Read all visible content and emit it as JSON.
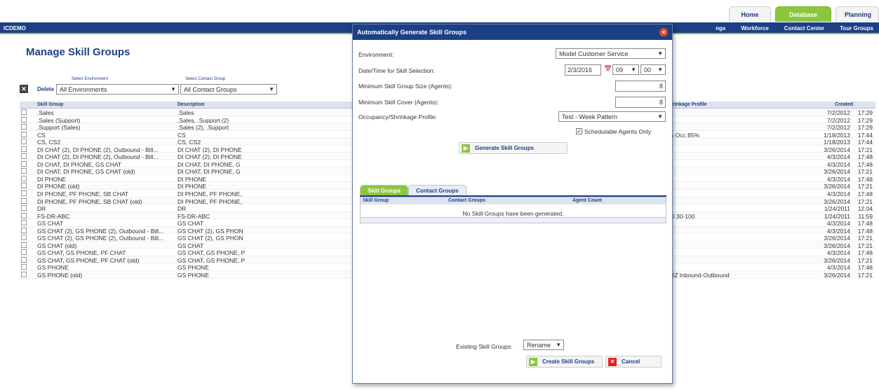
{
  "top_tabs": {
    "home": "Home",
    "database": "Database",
    "planning": "Planning"
  },
  "nav": {
    "brand": "ICDEMO",
    "links": [
      "ngs",
      "Workforce",
      "Contact Center",
      "Tour Groups"
    ]
  },
  "page": {
    "title": "Manage Skill Groups"
  },
  "filters": {
    "env_caption": "Select Environment",
    "cg_caption": "Select Contact Group",
    "delete_label": "Delete",
    "env_value": "All Environments",
    "cg_value": "All Contact Groups"
  },
  "grid": {
    "headers": {
      "skill_group": "Skill Group",
      "description": "Description",
      "profile": "/Shrinkage Profile",
      "created": "Created"
    },
    "rows": [
      {
        "name": ".Sales",
        "desc": ".Sales",
        "profile": "",
        "date": "7/2/2012",
        "time": "17:29"
      },
      {
        "name": ".Sales (Support)",
        "desc": ".Sales, .Support (2)",
        "profile": "",
        "date": "7/2/2012",
        "time": "17:29"
      },
      {
        "name": ".Support (Sales)",
        "desc": ".Sales (2), .Support",
        "profile": "",
        "date": "7/2/2012",
        "time": "17:29"
      },
      {
        "name": "CS",
        "desc": "CS",
        "profile": "3% Occ 85%",
        "date": "1/18/2013",
        "time": "17:44"
      },
      {
        "name": "CS, CS2",
        "desc": "CS, CS2",
        "profile": "",
        "date": "1/18/2013",
        "time": "17:44"
      },
      {
        "name": "DI CHAT (2), DI PHONE (2), Outbound - Bill...",
        "desc": "DI CHAT (2), DI PHONE",
        "profile": "",
        "date": "3/26/2014",
        "time": "17:21"
      },
      {
        "name": "DI CHAT (2), DI PHONE (2), Outbound - Bill...",
        "desc": "DI CHAT (2), DI PHONE",
        "profile": "",
        "date": "4/3/2014",
        "time": "17:48"
      },
      {
        "name": "DI CHAT, DI PHONE, GS CHAT",
        "desc": "DI CHAT, DI PHONE, G",
        "profile": "",
        "date": "4/3/2014",
        "time": "17:48"
      },
      {
        "name": "DI CHAT, DI PHONE, GS CHAT (old)",
        "desc": "DI CHAT, DI PHONE, G",
        "profile": "",
        "date": "3/26/2014",
        "time": "17:21"
      },
      {
        "name": "DI PHONE",
        "desc": "DI PHONE",
        "profile": "",
        "date": "4/3/2014",
        "time": "17:48"
      },
      {
        "name": "DI PHONE (old)",
        "desc": "DI PHONE",
        "profile": "",
        "date": "3/26/2014",
        "time": "17:21"
      },
      {
        "name": "DI PHONE, PF PHONE, SB CHAT",
        "desc": "DI PHONE, PF PHONE,",
        "profile": "",
        "date": "4/3/2014",
        "time": "17:48"
      },
      {
        "name": "DI PHONE, PF PHONE, SB CHAT (old)",
        "desc": "DI PHONE, PF PHONE,",
        "profile": "",
        "date": "3/26/2014",
        "time": "17:21"
      },
      {
        "name": "DR",
        "desc": "DR",
        "profile": "",
        "date": "1/24/2011",
        "time": "12:04"
      },
      {
        "name": "FS-DR-ABC",
        "desc": "FS-DR-ABC",
        "profile": "1-D 30-100",
        "date": "1/24/2011",
        "time": "11:59"
      },
      {
        "name": "GS CHAT",
        "desc": "GS CHAT",
        "profile": "",
        "date": "4/3/2014",
        "time": "17:48"
      },
      {
        "name": "GS CHAT (2), GS PHONE (2), Outbound - Bill...",
        "desc": "GS CHAT (2), GS PHON",
        "profile": "",
        "date": "4/3/2014",
        "time": "17:48"
      },
      {
        "name": "GS CHAT (2), GS PHONE (2), Outbound - Bill...",
        "desc": "GS CHAT (2), GS PHON",
        "profile": "",
        "date": "3/26/2014",
        "time": "17:21"
      },
      {
        "name": "GS CHAT (old)",
        "desc": "GS CHAT",
        "profile": "",
        "date": "3/26/2014",
        "time": "17:21"
      },
      {
        "name": "GS CHAT, GS PHONE, PF CHAT",
        "desc": "GS CHAT, GS PHONE, P",
        "profile": "",
        "date": "4/3/2014",
        "time": "17:48"
      },
      {
        "name": "GS CHAT, GS PHONE, PF CHAT (old)",
        "desc": "GS CHAT, GS PHONE, P",
        "profile": "",
        "date": "3/26/2014",
        "time": "17:21"
      },
      {
        "name": "GS PHONE",
        "desc": "GS PHONE",
        "profile": "",
        "date": "4/3/2014",
        "time": "17:48"
      },
      {
        "name": "GS PHONE (old)",
        "desc": "GS PHONE",
        "profile": "MRZ Inbound-Outbound",
        "date": "3/26/2014",
        "time": "17:21"
      }
    ]
  },
  "modal": {
    "title": "Automatically Generate Skill Groups",
    "environment_label": "Environment:",
    "environment_value": "Model Customer Service",
    "datetime_label": "Date/Time for Skill Selection:",
    "date_value": "2/3/2016",
    "hour_value": "09",
    "minute_value": "00",
    "min_size_label": "Minimum Skill Group Size (Agents):",
    "min_size_value": "8",
    "min_cover_label": "Minimum Skill Cover (Agents):",
    "min_cover_value": "8",
    "profile_label": "Occupancy/Shrinkage Profile:",
    "profile_value": "Test - Week Pattern",
    "schedulable_label": "Schedulable Agents Only",
    "generate_button": "Generate Skill Groups",
    "tabs": [
      "Skill Groups",
      "Contact Groups"
    ],
    "results_headers": [
      "Skill Group",
      "Contact Groups",
      "Agent Count"
    ],
    "results_empty": "No Skill Groups have been generated.",
    "existing_label": "Existing Skill Groups:",
    "existing_value": "Rename",
    "create_button": "Create Skill Groups",
    "cancel_button": "Cancel"
  }
}
